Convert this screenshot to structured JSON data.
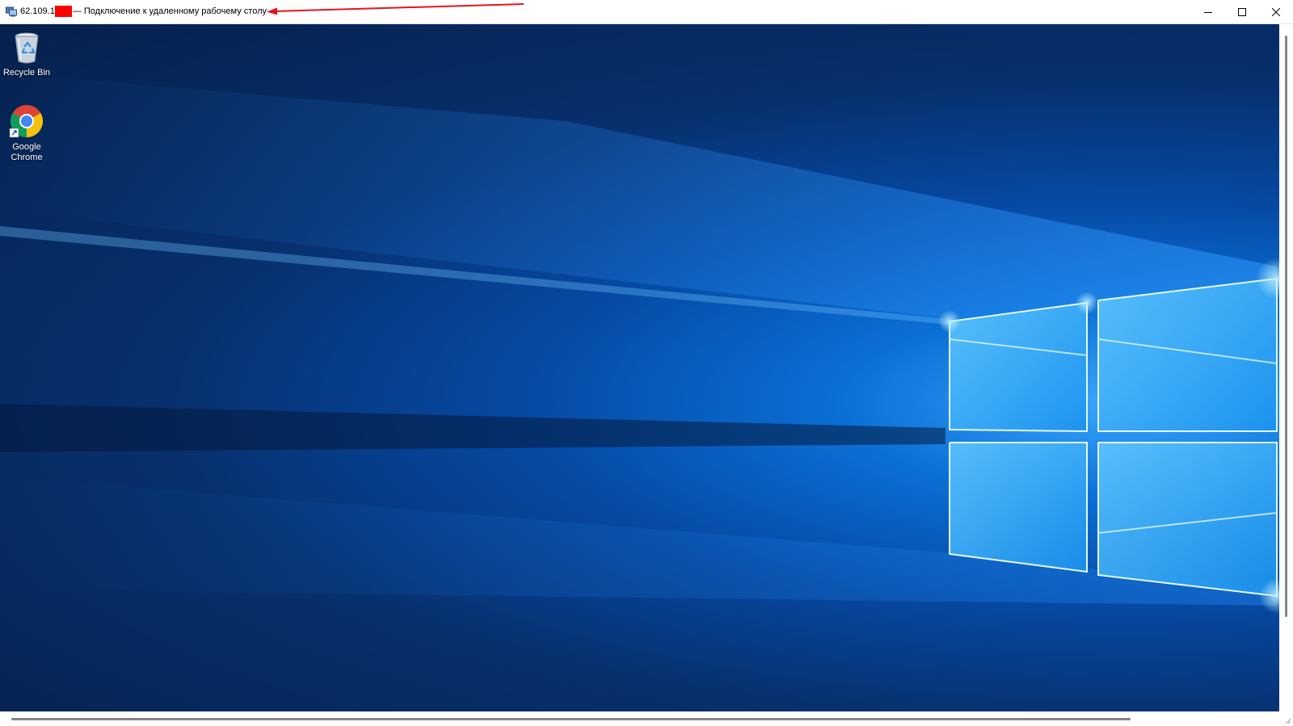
{
  "window": {
    "title_ip": "62.109.1",
    "title_suffix": "— Подключение к удаленному рабочему столу",
    "controls": {
      "minimize": "minimize-icon",
      "maximize": "maximize-icon",
      "close": "close-icon"
    }
  },
  "desktop": {
    "icons": [
      {
        "label": "Recycle Bin",
        "icon": "recycle-bin-icon"
      },
      {
        "label": "Google Chrome",
        "icon": "chrome-icon"
      }
    ]
  },
  "colors": {
    "annotation": "#e8141c",
    "redaction": "#ff0000",
    "wallpaper_dark": "#05204b",
    "wallpaper_light": "#3aa8ff"
  }
}
